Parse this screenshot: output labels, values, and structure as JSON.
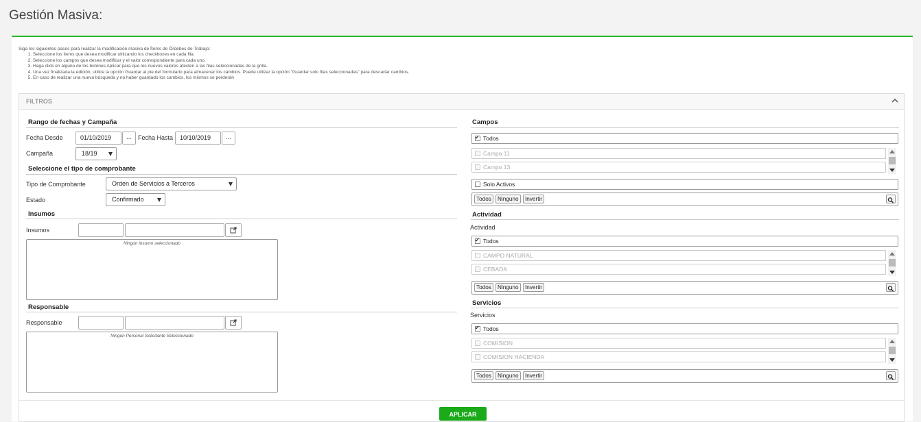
{
  "page": {
    "title": "Gestión Masiva:"
  },
  "instructions": {
    "intro": "Siga los siguientes pasos para realizar la modificación masiva de Ítems de Órdebes de Trabajo:",
    "steps": [
      "Seleccione los ítems que desea modificar utilizando los checkboxes en cada fila.",
      "Seleccione los campos que desea modificar y el valor correspondiente para cada uno.",
      "Haga click en alguno de los botones Aplicar para que los nuevos valores afecten a las filas seleccionadas de la grilla.",
      "Una vez finalizada la edición, utilice la opción Guardar al pie del formulario para almacenar los cambios. Puede utilizar la opción \"Guardar solo filas seleccionadas\" para descartar cambios.",
      "En caso de realizar una nueva búsqueda y no haber guardado los cambios, los mismos se perderán"
    ]
  },
  "filters": {
    "title": "FILTROS",
    "dates": {
      "section_title": "Rango de fechas y Campaña",
      "from_label": "Fecha Desde",
      "from_value": "01/10/2019",
      "to_label": "Fecha Hasta",
      "to_value": "10/10/2019",
      "picker_label": "...",
      "campaign_label": "Campaña",
      "campaign_value": "18/19"
    },
    "voucher": {
      "section_title": "Seleccione el tipo de comprobante",
      "type_label": "Tipo de Comprobante",
      "type_value": "Orden de Servicios a Terceros",
      "state_label": "Estado",
      "state_value": "Confirmado"
    },
    "insumos": {
      "section_title": "Insumos",
      "field_label": "Insumos",
      "code_value": "",
      "desc_value": "",
      "empty_text": "Ningún insumo seleccionado"
    },
    "responsable": {
      "section_title": "Responsable",
      "field_label": "Responsable",
      "code_value": "",
      "desc_value": "",
      "empty_text": "Ningún Personal Solicitante Seleccionado"
    },
    "campos": {
      "section_title": "Campos",
      "all_label": "Todos",
      "items": [
        "Campo 11",
        "Campo 13"
      ],
      "active_label": "Solo Activos",
      "btn_all": "Todos",
      "btn_none": "Ninguno",
      "btn_invert": "Invertir"
    },
    "actividad": {
      "section_title": "Actividad",
      "field_label": "Actividad",
      "all_label": "Todos",
      "items": [
        "CAMPO NATURAL",
        "CEBADA"
      ],
      "btn_all": "Todos",
      "btn_none": "Ninguno",
      "btn_invert": "Invertir"
    },
    "servicios": {
      "section_title": "Servicios",
      "field_label": "Servicios",
      "all_label": "Todos",
      "items": [
        "COMISION",
        "COMISION HACIENDA"
      ],
      "btn_all": "Todos",
      "btn_none": "Ninguno",
      "btn_invert": "Invertir"
    }
  },
  "footer": {
    "apply_label": "APLICAR"
  },
  "colors": {
    "accent": "#2ab52a",
    "apply_button": "#1aaa1a"
  }
}
